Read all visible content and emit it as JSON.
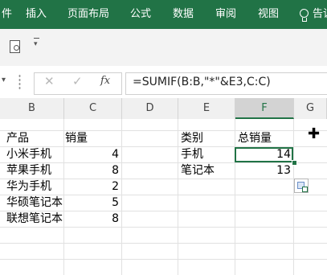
{
  "ribbon": {
    "tabs": [
      {
        "label": "件"
      },
      {
        "label": "插入"
      },
      {
        "label": "页面布局"
      },
      {
        "label": "公式"
      },
      {
        "label": "数据"
      },
      {
        "label": "审阅"
      },
      {
        "label": "视图"
      }
    ],
    "tell_me": "告诉"
  },
  "formula_bar": {
    "formula": "=SUMIF(B:B,\"*\"&E3,C:C)",
    "fx_label": "fx",
    "cancel_symbol": "✕",
    "enter_symbol": "✓"
  },
  "columns": [
    "B",
    "C",
    "D",
    "E",
    "F",
    "G"
  ],
  "selected_column": "F",
  "cells": {
    "b_header": "产品",
    "c_header": "销量",
    "e_header": "类别",
    "f_header": "总销量",
    "products": [
      {
        "name": "小米手机",
        "sales": "4"
      },
      {
        "name": "苹果手机",
        "sales": "8"
      },
      {
        "name": "华为手机",
        "sales": "2"
      },
      {
        "name": "华硕笔记本",
        "sales": "5"
      },
      {
        "name": "联想笔记本",
        "sales": "8"
      }
    ],
    "categories": [
      {
        "name": "手机",
        "total": "14"
      },
      {
        "name": "笔记本",
        "total": "13"
      }
    ]
  },
  "colors": {
    "ribbon_green": "#217346",
    "selection_green": "#217346"
  }
}
